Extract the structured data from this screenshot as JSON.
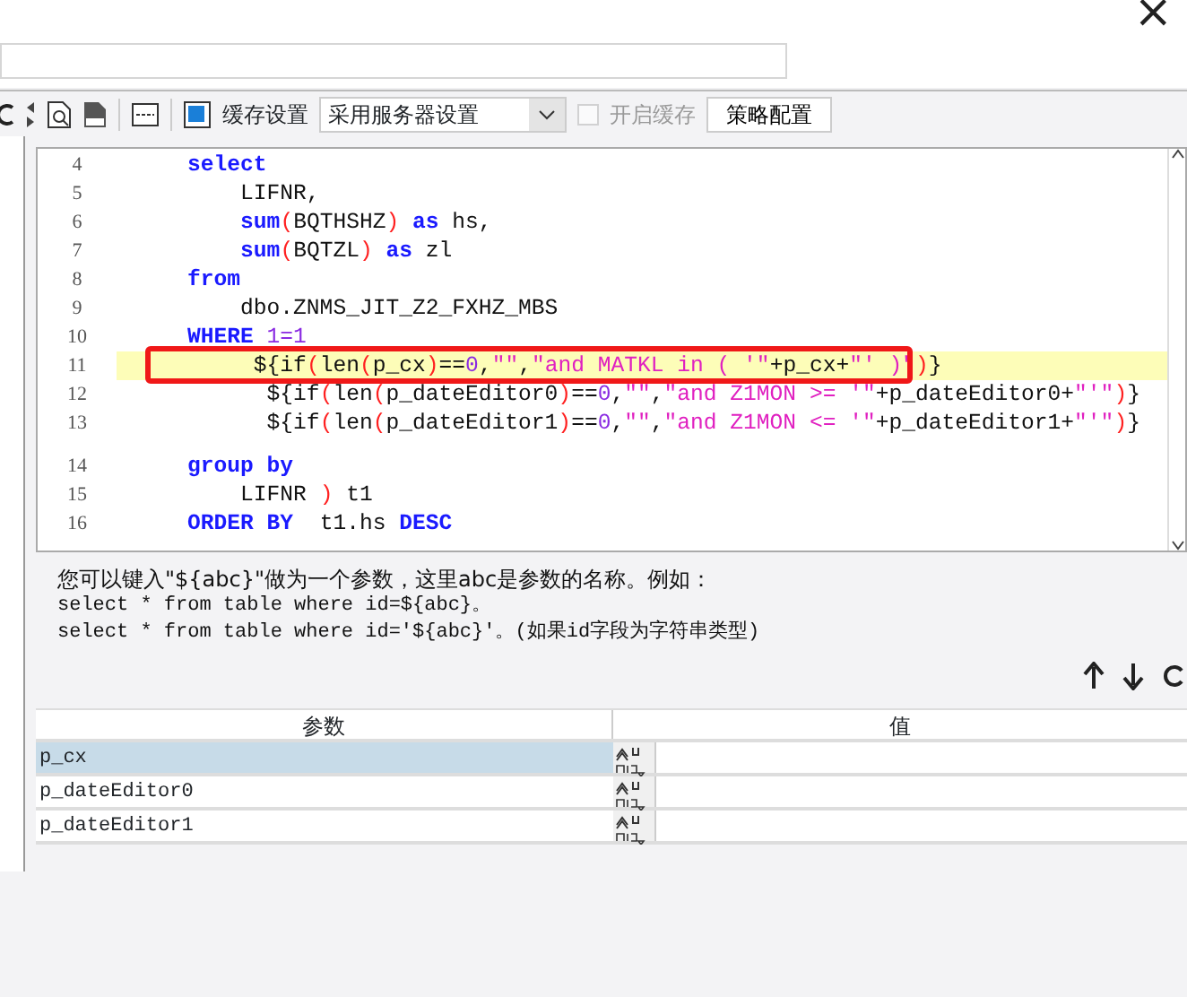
{
  "window": {
    "close": "×"
  },
  "toolbar": {
    "cache_label": "缓存设置",
    "cache_select": "采用服务器设置",
    "enable_cache": {
      "label": "开启缓存",
      "checked": false,
      "disabled": true
    },
    "strategy_button": "策略配置"
  },
  "editor": {
    "lines": [
      {
        "number": "4",
        "current": false,
        "boxed": false,
        "gap_before": false,
        "segments": [
          {
            "kind": "kw",
            "text": "    select"
          }
        ]
      },
      {
        "number": "5",
        "current": false,
        "boxed": false,
        "gap_before": false,
        "segments": [
          {
            "kind": "plain",
            "text": "        LIFNR,"
          }
        ]
      },
      {
        "number": "6",
        "current": false,
        "boxed": false,
        "gap_before": false,
        "segments": [
          {
            "kind": "kw",
            "text": "        sum"
          },
          {
            "kind": "paren",
            "text": "("
          },
          {
            "kind": "plain",
            "text": "BQTHSHZ"
          },
          {
            "kind": "paren",
            "text": ")"
          },
          {
            "kind": "kw",
            "text": " as"
          },
          {
            "kind": "plain",
            "text": " hs,"
          }
        ]
      },
      {
        "number": "7",
        "current": false,
        "boxed": false,
        "gap_before": false,
        "segments": [
          {
            "kind": "kw",
            "text": "        sum"
          },
          {
            "kind": "paren",
            "text": "("
          },
          {
            "kind": "plain",
            "text": "BQTZL"
          },
          {
            "kind": "paren",
            "text": ")"
          },
          {
            "kind": "kw",
            "text": " as"
          },
          {
            "kind": "plain",
            "text": " zl"
          }
        ]
      },
      {
        "number": "8",
        "current": false,
        "boxed": false,
        "gap_before": false,
        "segments": [
          {
            "kind": "kw",
            "text": "    from"
          }
        ]
      },
      {
        "number": "9",
        "current": false,
        "boxed": false,
        "gap_before": false,
        "segments": [
          {
            "kind": "plain",
            "text": "        dbo.ZNMS_JIT_Z2_FXHZ_MBS"
          }
        ]
      },
      {
        "number": "10",
        "current": false,
        "boxed": false,
        "gap_before": false,
        "segments": [
          {
            "kind": "kw",
            "text": "    WHERE"
          },
          {
            "kind": "num",
            "text": " 1=1"
          }
        ]
      },
      {
        "number": "11",
        "current": true,
        "boxed": true,
        "gap_before": false,
        "segments": [
          {
            "kind": "plain",
            "text": "         ${if"
          },
          {
            "kind": "paren",
            "text": "("
          },
          {
            "kind": "plain",
            "text": "len"
          },
          {
            "kind": "paren",
            "text": "("
          },
          {
            "kind": "plain",
            "text": "p_cx"
          },
          {
            "kind": "paren",
            "text": ")"
          },
          {
            "kind": "plain",
            "text": "=="
          },
          {
            "kind": "num",
            "text": "0"
          },
          {
            "kind": "plain",
            "text": ","
          },
          {
            "kind": "str",
            "text": "\"\""
          },
          {
            "kind": "plain",
            "text": ","
          },
          {
            "kind": "str",
            "text": "\"and MATKL in ( '\""
          },
          {
            "kind": "plain",
            "text": "+p_cx+"
          },
          {
            "kind": "str",
            "text": "\"' )\""
          },
          {
            "kind": "paren",
            "text": ")"
          },
          {
            "kind": "plain",
            "text": "}"
          }
        ]
      },
      {
        "number": "12",
        "current": false,
        "boxed": false,
        "gap_before": false,
        "segments": [
          {
            "kind": "plain",
            "text": "          ${if"
          },
          {
            "kind": "paren",
            "text": "("
          },
          {
            "kind": "plain",
            "text": "len"
          },
          {
            "kind": "paren",
            "text": "("
          },
          {
            "kind": "plain",
            "text": "p_dateEditor0"
          },
          {
            "kind": "paren",
            "text": ")"
          },
          {
            "kind": "plain",
            "text": "=="
          },
          {
            "kind": "num",
            "text": "0"
          },
          {
            "kind": "plain",
            "text": ","
          },
          {
            "kind": "str",
            "text": "\"\""
          },
          {
            "kind": "plain",
            "text": ","
          },
          {
            "kind": "str",
            "text": "\"and Z1MON >= '\""
          },
          {
            "kind": "plain",
            "text": "+p_dateEditor0+"
          },
          {
            "kind": "str",
            "text": "\"'\""
          },
          {
            "kind": "paren",
            "text": ")"
          },
          {
            "kind": "plain",
            "text": "}"
          }
        ]
      },
      {
        "number": "13",
        "current": false,
        "boxed": false,
        "gap_before": false,
        "segments": [
          {
            "kind": "plain",
            "text": "          ${if"
          },
          {
            "kind": "paren",
            "text": "("
          },
          {
            "kind": "plain",
            "text": "len"
          },
          {
            "kind": "paren",
            "text": "("
          },
          {
            "kind": "plain",
            "text": "p_dateEditor1"
          },
          {
            "kind": "paren",
            "text": ")"
          },
          {
            "kind": "plain",
            "text": "=="
          },
          {
            "kind": "num",
            "text": "0"
          },
          {
            "kind": "plain",
            "text": ","
          },
          {
            "kind": "str",
            "text": "\"\""
          },
          {
            "kind": "plain",
            "text": ","
          },
          {
            "kind": "str",
            "text": "\"and Z1MON <= '\""
          },
          {
            "kind": "plain",
            "text": "+p_dateEditor1+"
          },
          {
            "kind": "str",
            "text": "\"'\""
          },
          {
            "kind": "paren",
            "text": ")"
          },
          {
            "kind": "plain",
            "text": "}"
          }
        ]
      },
      {
        "number": "14",
        "current": false,
        "boxed": false,
        "gap_before": true,
        "segments": [
          {
            "kind": "kw",
            "text": "    group by"
          }
        ]
      },
      {
        "number": "15",
        "current": false,
        "boxed": false,
        "gap_before": false,
        "segments": [
          {
            "kind": "plain",
            "text": "        LIFNR "
          },
          {
            "kind": "paren",
            "text": ")"
          },
          {
            "kind": "plain",
            "text": " t1"
          }
        ]
      },
      {
        "number": "16",
        "current": false,
        "boxed": false,
        "gap_before": false,
        "segments": [
          {
            "kind": "kw",
            "text": "    ORDER BY"
          },
          {
            "kind": "plain",
            "text": "  t1.hs "
          },
          {
            "kind": "kw",
            "text": "DESC"
          }
        ]
      }
    ]
  },
  "hint": [
    "您可以键入\"${abc}\"做为一个参数，这里abc是参数的名称。例如：",
    "select * from table where id=${abc}。",
    "select * from table where id='${abc}'。(如果id字段为字符串类型)"
  ],
  "params": {
    "columns": [
      "参数",
      "值"
    ],
    "rows": [
      {
        "name": "p_cx",
        "selected": true
      },
      {
        "name": "p_dateEditor0",
        "selected": false
      },
      {
        "name": "p_dateEditor1",
        "selected": false
      }
    ]
  }
}
